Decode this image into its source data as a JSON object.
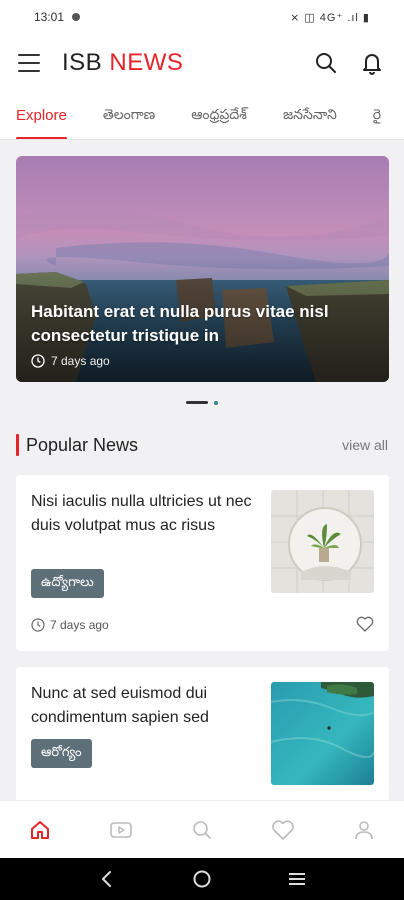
{
  "status_bar": {
    "time": "13:01",
    "right_indicators": "⨯ ◫ 4G⁺ .ıl ▮"
  },
  "header": {
    "brand_prefix": "ISB",
    "brand_suffix": "NEWS",
    "icons": [
      "menu-icon",
      "search-icon",
      "bell-icon"
    ]
  },
  "tabs": [
    {
      "label": "Explore",
      "active": true
    },
    {
      "label": "తెలంగాణ",
      "active": false
    },
    {
      "label": "ఆంధ్రప్రదేశ్",
      "active": false
    },
    {
      "label": "జనసేనాని",
      "active": false
    },
    {
      "label": "రై",
      "active": false
    }
  ],
  "hero": {
    "title": "Habitant erat et nulla purus vitae nisl consectetur tristique in",
    "time": "7 days ago",
    "slides": 2,
    "active_slide": 1
  },
  "popular": {
    "title": "Popular News",
    "view_all": "view all",
    "items": [
      {
        "title": "Nisi iaculis nulla ultricies ut nec duis volutpat mus ac risus",
        "tag": "ఉద్యోగాలు",
        "time": "7 days ago",
        "thumb": "plant-in-bathroom"
      },
      {
        "title": "Nunc at sed euismod dui condimentum sapien sed",
        "tag": "ఆరోగ్యం",
        "thumb": "turquoise-lagoon"
      }
    ]
  },
  "bottom_nav": [
    "home-icon",
    "video-icon",
    "search-icon",
    "heart-icon",
    "profile-icon"
  ],
  "colors": {
    "accent": "#e6242a",
    "tag_bg": "#5d6f78",
    "background": "#f1f1f3"
  }
}
